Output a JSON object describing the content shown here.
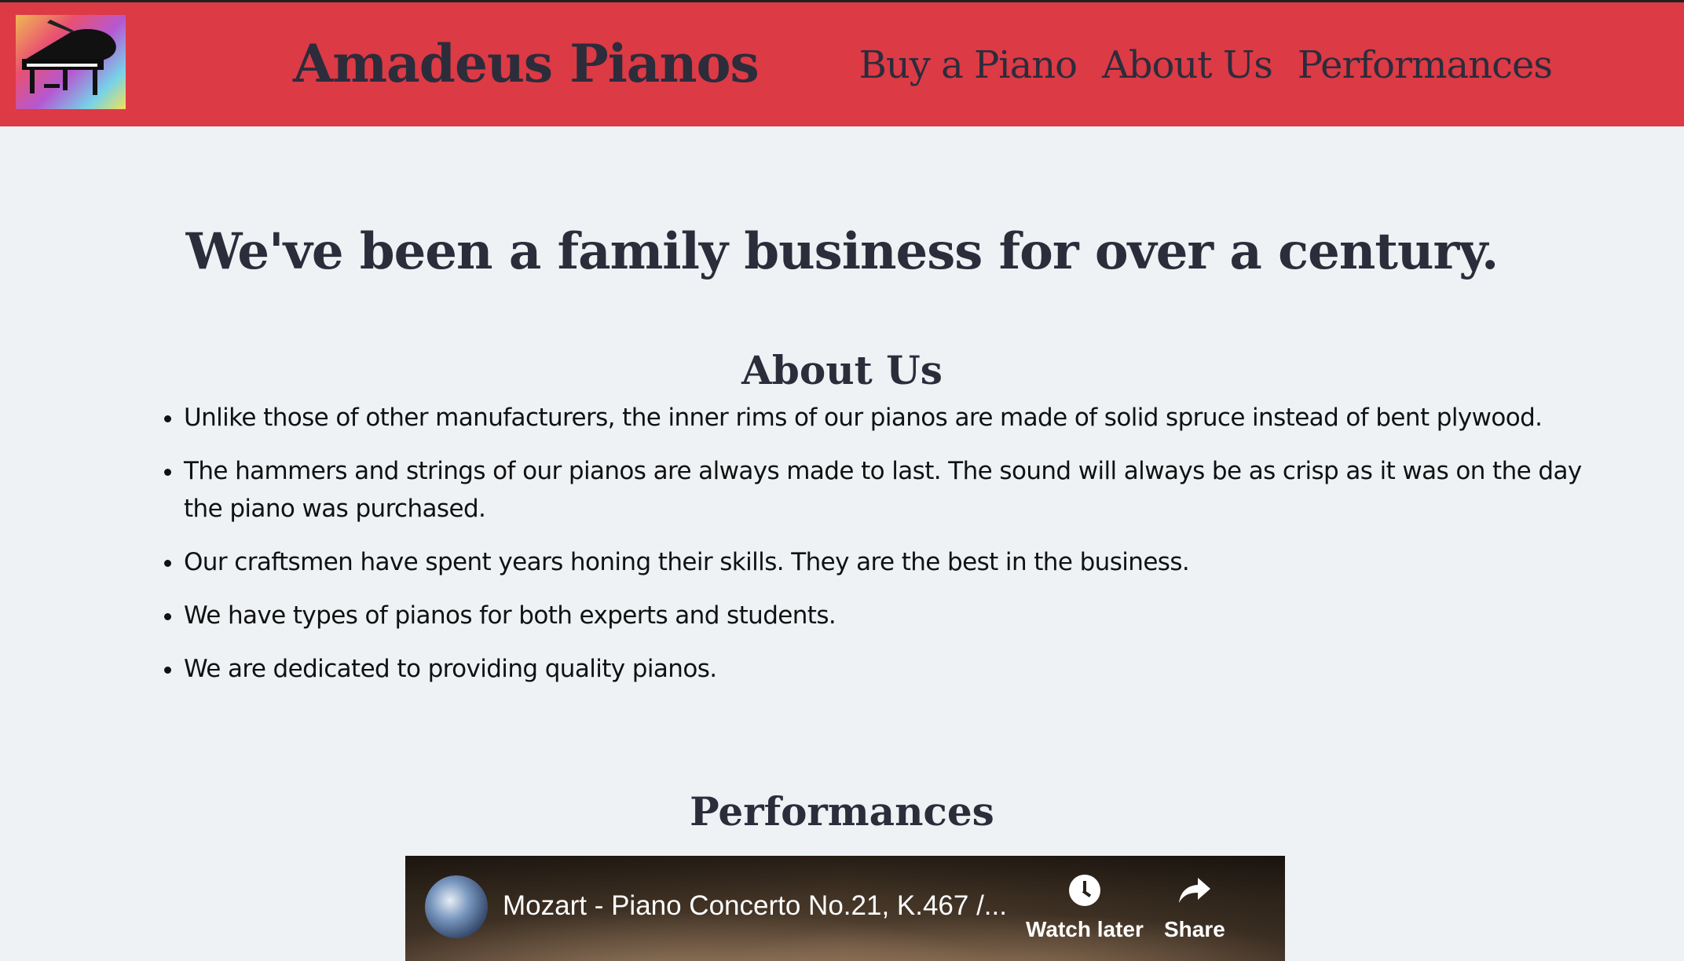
{
  "header": {
    "brand": "Amadeus Pianos",
    "nav": [
      "Buy a Piano",
      "About Us",
      "Performances"
    ],
    "colors": {
      "background": "#dc3a45",
      "text": "#2c2c3b"
    }
  },
  "hero": {
    "heading": "We've been a family business for over a century."
  },
  "about": {
    "heading": "About Us",
    "items": [
      "Unlike those of other manufacturers, the inner rims of our pianos are made of solid spruce instead of bent plywood.",
      "The hammers and strings of our pianos are always made to last. The sound will always be as crisp as it was on the day the piano was purchased.",
      "Our craftsmen have spent years honing their skills. They are the best in the business.",
      "We have types of pianos for both experts and students.",
      "We are dedicated to providing quality pianos."
    ]
  },
  "performances": {
    "heading": "Performances",
    "video": {
      "title": "Mozart - Piano Concerto No.21, K.467 /...",
      "watch_later_label": "Watch later",
      "share_label": "Share"
    }
  }
}
